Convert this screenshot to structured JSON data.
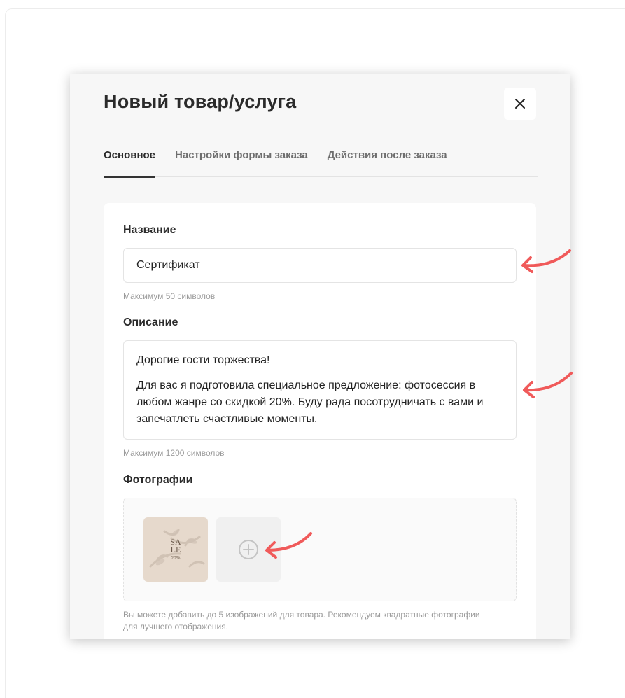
{
  "modal": {
    "title": "Новый товар/услуга",
    "close_icon": "close-icon"
  },
  "tabs": [
    {
      "label": "Основное",
      "active": true
    },
    {
      "label": "Настройки формы заказа",
      "active": false
    },
    {
      "label": "Действия после заказа",
      "active": false
    }
  ],
  "form": {
    "name": {
      "label": "Название",
      "value": "Сертификат",
      "hint": "Максимум 50 символов"
    },
    "description": {
      "label": "Описание",
      "paragraphs": [
        "Дорогие гости торжества!",
        "Для вас я подготовила специальное предложение: фотосессия в любом жанре со скидкой 20%. Буду рада посотрудничать с вами и запечатлеть счастливые моменты."
      ],
      "hint": "Максимум 1200 символов"
    },
    "photos": {
      "label": "Фотографии",
      "thumbnail": {
        "line1": "SA",
        "line2": "LE",
        "line3": "20%"
      },
      "add_icon": "plus-circle-icon",
      "hint": "Вы можете добавить до 5 изображений для товара. Рекомендуем квадратные фотографии для лучшего отображения."
    }
  },
  "colors": {
    "annotation_arrow": "#f05a5a",
    "modal_bg": "#f7f7f7",
    "active_tab_underline": "#333333"
  }
}
